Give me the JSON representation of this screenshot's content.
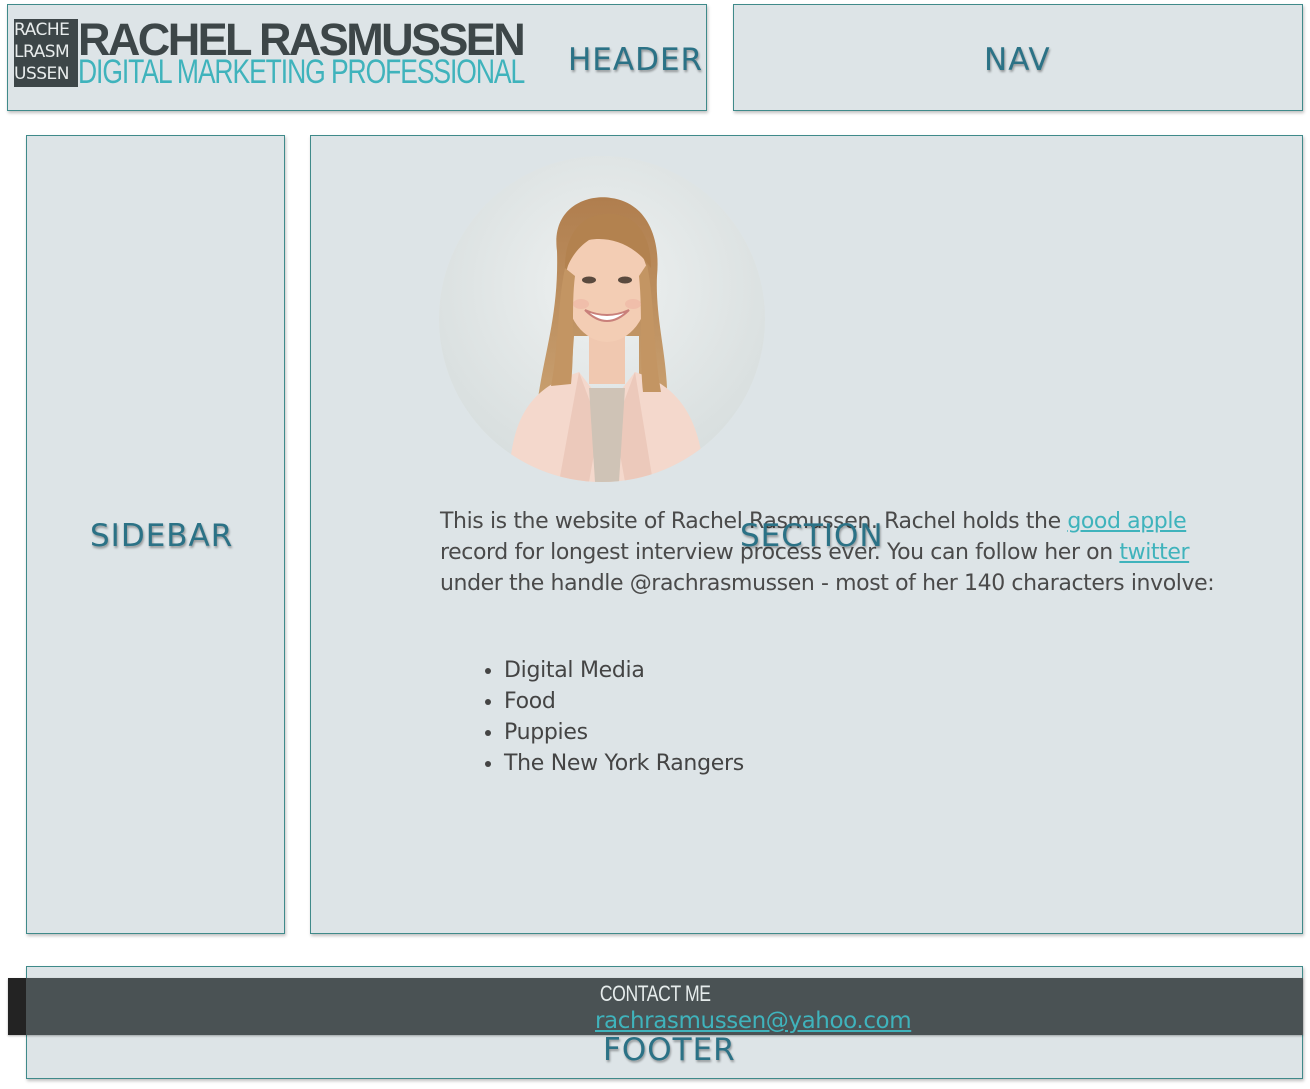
{
  "header": {
    "logo_mark_lines": [
      "RACHE",
      "LRASM",
      "USSEN"
    ],
    "name": "RACHEL RASMUSSEN",
    "tagline": "DIGITAL MARKETING PROFESSIONAL",
    "label": "HEADER"
  },
  "nav": {
    "label": "NAV"
  },
  "sidebar": {
    "label": "SIDEBAR"
  },
  "section": {
    "label": "SECTION",
    "intro": {
      "part1": "This is the website of Rachel Rasmussen. Rachel holds the ",
      "link1": "good apple",
      "part2": " record for longest interview process ever. You can follow her on ",
      "link2": "twitter",
      "part3": " under the handle @rachrasmussen - most of her 140 characters involve:"
    },
    "interests": [
      "Digital Media",
      "Food",
      "Puppies",
      "The New York Rangers"
    ]
  },
  "footer": {
    "label": "FOOTER",
    "contact_title": "CONTACT ME",
    "contact_email": "rachrasmussen@yahoo.com"
  },
  "colors": {
    "accent": "#3fb3bc",
    "dark": "#3d4648",
    "box_fill": "#dde4e7",
    "box_border": "#3f8a8a",
    "label": "#2b7286"
  }
}
